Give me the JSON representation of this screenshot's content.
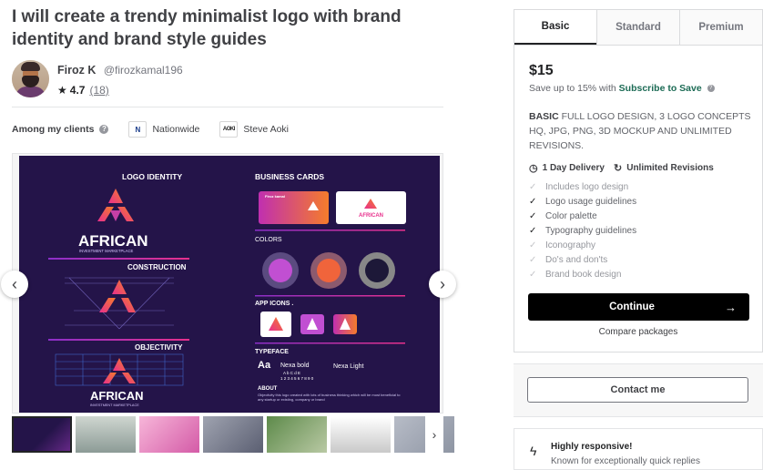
{
  "gig": {
    "title": "I will create a trendy minimalist logo with brand identity and brand style guides"
  },
  "seller": {
    "name": "Firoz K",
    "handle": "@firozkamal196",
    "rating": "4.7",
    "reviews": "(18)"
  },
  "clients": {
    "label": "Among my clients",
    "items": [
      {
        "name": "Nationwide",
        "logo_icon": "nationwide-logo"
      },
      {
        "name": "Steve Aoki",
        "logo_icon": "steve-aoki-logo"
      }
    ]
  },
  "gallery": {
    "slide": {
      "sections": {
        "logo_identity": "LOGO IDENTITY",
        "business_cards": "BUSINESS CARDS",
        "construction": "CONSTRUCTION",
        "colors": "COLORS",
        "app_icons": "APP ICONS .",
        "objectivity": "OBJECTIVITY",
        "typeface": "TYPEFACE",
        "about": "ABOUT"
      },
      "brand_name": "AFRICAN",
      "brand_tagline": "INVESTMENT MARKETPLACE",
      "card_name": "Firoz kamal",
      "font_sample": "Aa",
      "font_bold": "Nexa bold",
      "font_light": "Nexa Light",
      "font_chars_1": "A b C d E",
      "font_chars_2": "1 2 3 4 5 6 7 8 9 0",
      "about_text": "Objectivity this logo created with lots of business thinking which will be most beneficial to any startup or existing, company or brand"
    },
    "thumb_count": 7
  },
  "packages": {
    "tabs": [
      "Basic",
      "Standard",
      "Premium"
    ],
    "active_tab": "Basic",
    "price": "$15",
    "save_prefix": "Save up to 15% with",
    "save_link": "Subscribe to Save",
    "desc_title": "BASIC",
    "desc_body": "FULL LOGO DESIGN, 3 LOGO CONCEPTS HQ, JPG, PNG, 3D MOCKUP AND UNLIMITED REVISIONS.",
    "delivery": "1 Day Delivery",
    "revisions": "Unlimited Revisions",
    "features": [
      {
        "label": "Includes logo design",
        "included": false
      },
      {
        "label": "Logo usage guidelines",
        "included": true
      },
      {
        "label": "Color palette",
        "included": true
      },
      {
        "label": "Typography guidelines",
        "included": true
      },
      {
        "label": "Iconography",
        "included": false
      },
      {
        "label": "Do's and don'ts",
        "included": false
      },
      {
        "label": "Brand book design",
        "included": false
      }
    ],
    "continue_label": "Continue",
    "compare_label": "Compare packages"
  },
  "contact": {
    "label": "Contact me"
  },
  "responsive": {
    "title": "Highly responsive!",
    "subtitle": "Known for exceptionally quick replies"
  },
  "colors": {
    "brand_green": "#1dbf73",
    "slide_bg": "#241449",
    "accent_pink": "#e8308c",
    "accent_orange": "#f57c2b",
    "accent_purple": "#8b2fc9"
  }
}
